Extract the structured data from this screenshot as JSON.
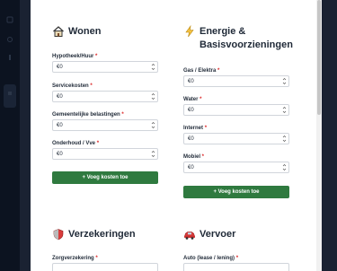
{
  "sections": {
    "wonen": {
      "title": "Wonen",
      "icon": "house-icon",
      "fields": [
        {
          "label": "Hypotheek/Huur",
          "required": "*",
          "value": "€0"
        },
        {
          "label": "Servicekosten",
          "required": "*",
          "value": "€0"
        },
        {
          "label": "Gemeentelijke belastingen",
          "required": "*",
          "value": "€0"
        },
        {
          "label": "Onderhoud / Vve",
          "required": "*",
          "value": "€0"
        }
      ],
      "add_label": "+ Voeg kosten toe"
    },
    "energie": {
      "title_line1": "Energie &",
      "title_line2": "Basisvoorzieningen",
      "icon": "lightning-icon",
      "fields": [
        {
          "label": "Gas / Elektra",
          "required": "*",
          "value": "€0"
        },
        {
          "label": "Water",
          "required": "*",
          "value": "€0"
        },
        {
          "label": "Internet",
          "required": "*",
          "value": "€0"
        },
        {
          "label": "Mobiel",
          "required": "*",
          "value": "€0"
        }
      ],
      "add_label": "+ Voeg kosten toe"
    },
    "verzekeringen": {
      "title": "Verzekeringen",
      "icon": "shield-icon",
      "fields": [
        {
          "label": "Zorgverzekering",
          "required": "*"
        }
      ]
    },
    "vervoer": {
      "title": "Vervoer",
      "icon": "car-icon",
      "fields": [
        {
          "label": "Auto (lease / lening)",
          "required": "*"
        }
      ]
    }
  },
  "colors": {
    "accent": "#2f7a3f",
    "required": "#dc2626",
    "backdrop": "#141c2b"
  }
}
